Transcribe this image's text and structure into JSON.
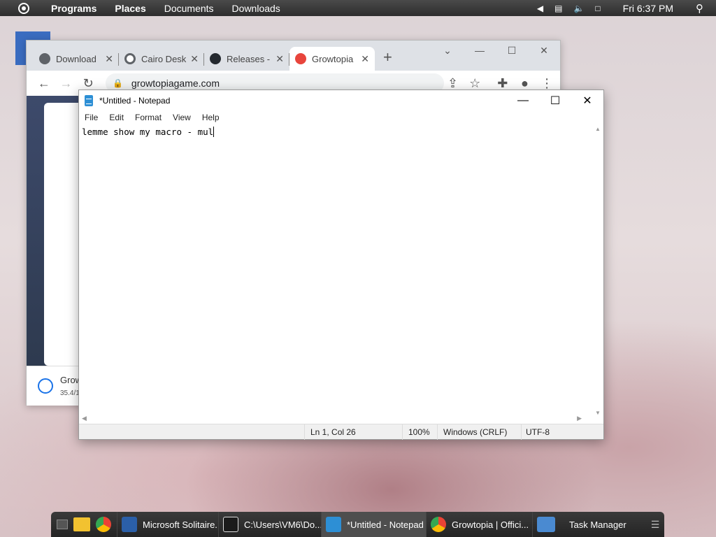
{
  "top_panel": {
    "menus": [
      "Programs",
      "Places",
      "Documents",
      "Downloads"
    ],
    "clock": "Fri 6:37 PM"
  },
  "chrome": {
    "tabs": [
      {
        "title": "Download",
        "favicon_color": "#5f6368"
      },
      {
        "title": "Cairo Desk",
        "favicon_color": "#5f6368"
      },
      {
        "title": "Releases -",
        "favicon_color": "#24292f"
      },
      {
        "title": "Growtopia",
        "favicon_color": "#e8453c"
      }
    ],
    "url": "growtopiagame.com",
    "download": {
      "name": "Grow",
      "size": "35.4/1"
    }
  },
  "notepad": {
    "title": "*Untitled - Notepad",
    "menu": [
      "File",
      "Edit",
      "Format",
      "View",
      "Help"
    ],
    "text": "lemme show my macro - mul",
    "status": {
      "position": "Ln 1, Col 26",
      "zoom": "100%",
      "line_ending": "Windows (CRLF)",
      "encoding": "UTF-8"
    }
  },
  "taskbar": {
    "items": [
      {
        "label": "Microsoft Solitaire...",
        "icon_color": "#2b5fa8"
      },
      {
        "label": "C:\\Users\\VM6\\Do...",
        "icon_color": "#1b1b1b"
      },
      {
        "label": "*Untitled - Notepad",
        "icon_color": "#2d8fd5"
      },
      {
        "label": "Growtopia | Offici...",
        "icon_color": "#e8453c"
      },
      {
        "label": "Task Manager",
        "icon_color": "#4a8ad1"
      }
    ]
  }
}
